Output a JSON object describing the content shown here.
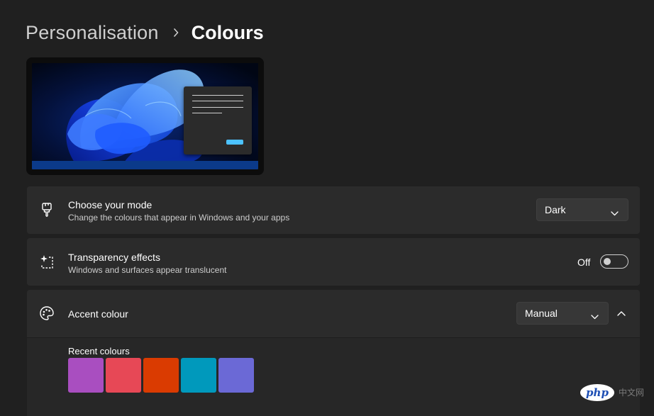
{
  "breadcrumb": {
    "parent": "Personalisation",
    "current": "Colours"
  },
  "preview": {
    "accent_color": "#4cc2ff",
    "taskbar_color": "#0b3a8a"
  },
  "mode": {
    "title": "Choose your mode",
    "description": "Change the colours that appear in Windows and your apps",
    "selected": "Dark",
    "icon": "brush-icon"
  },
  "transparency": {
    "title": "Transparency effects",
    "description": "Windows and surfaces appear translucent",
    "state_label": "Off",
    "icon": "transparency-sparkle-icon"
  },
  "accent": {
    "title": "Accent colour",
    "selected": "Manual",
    "icon": "palette-icon",
    "recent_label": "Recent colours",
    "recent_colours": [
      "#a94ec0",
      "#e74856",
      "#da3b01",
      "#0099bc",
      "#6b69d6"
    ]
  },
  "watermark": {
    "logo": "php",
    "text": "中文网"
  }
}
